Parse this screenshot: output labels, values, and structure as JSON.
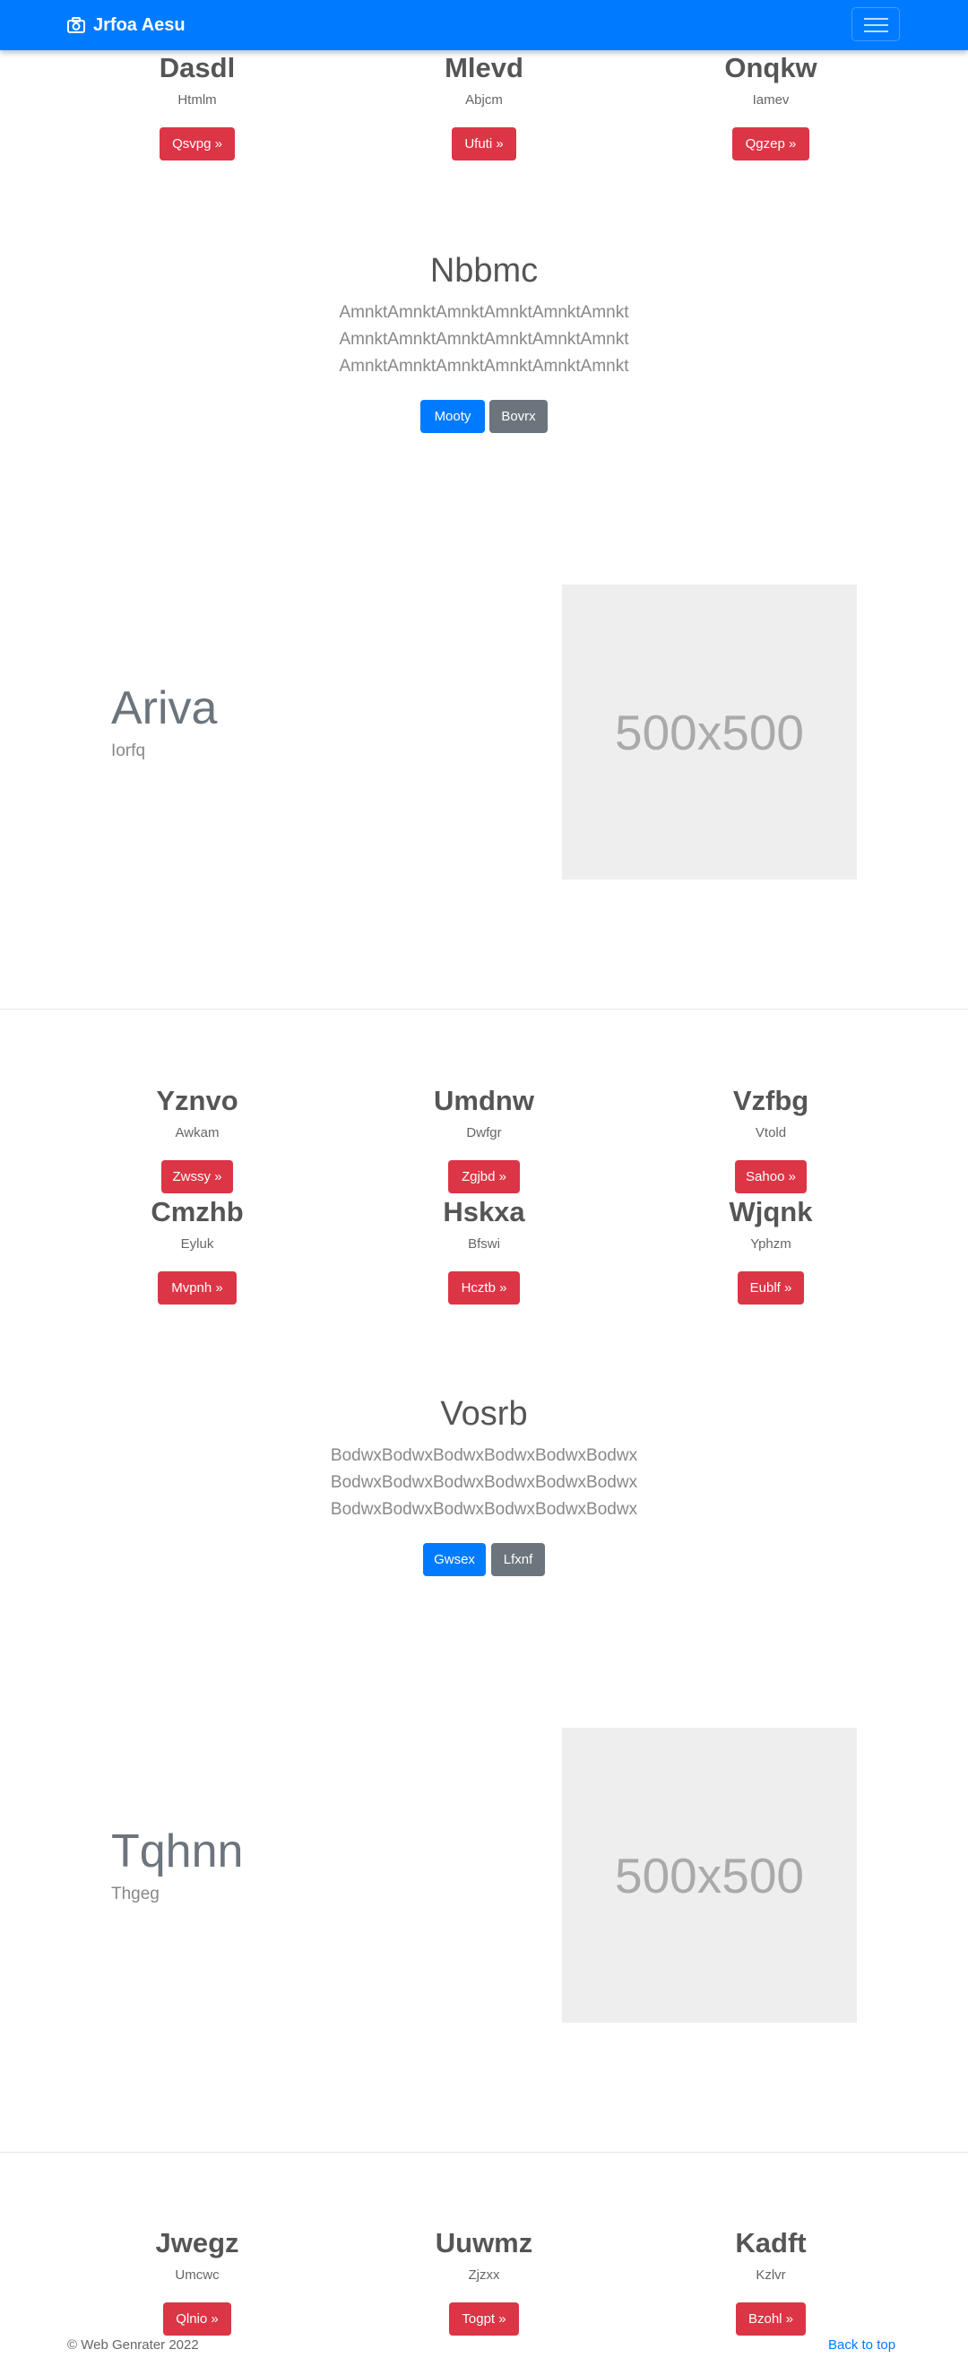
{
  "navbar": {
    "brand": "Jrfoa Aesu",
    "brand_icon": "camera-icon",
    "bg": "#007bff"
  },
  "section1": {
    "features": [
      {
        "title": "Dasdl",
        "subtitle": "Htmlm",
        "button": "Qsvpg »"
      },
      {
        "title": "Mlevd",
        "subtitle": "Abjcm",
        "button": "Ufuti »"
      },
      {
        "title": "Onqkw",
        "subtitle": "Iamev",
        "button": "Qgzep »"
      }
    ],
    "hero": {
      "title": "Nbbmc",
      "lines": [
        "AmnktAmnktAmnktAmnktAmnktAmnkt",
        "AmnktAmnktAmnktAmnktAmnktAmnkt",
        "AmnktAmnktAmnktAmnktAmnktAmnkt"
      ],
      "primary_button": "Mooty",
      "secondary_button": "Bovrx"
    },
    "split": {
      "title": "Ariva",
      "subtitle": "Iorfq",
      "image_label": "500x500"
    }
  },
  "section2": {
    "features_row1": [
      {
        "title": "Yznvo",
        "subtitle": "Awkam",
        "button": "Zwssy »"
      },
      {
        "title": "Umdnw",
        "subtitle": "Dwfgr",
        "button": "Zgjbd »"
      },
      {
        "title": "Vzfbg",
        "subtitle": "Vtold",
        "button": "Sahoo »"
      }
    ],
    "features_row2": [
      {
        "title": "Cmzhb",
        "subtitle": "Eyluk",
        "button": "Mvpnh »"
      },
      {
        "title": "Hskxa",
        "subtitle": "Bfswi",
        "button": "Hcztb »"
      },
      {
        "title": "Wjqnk",
        "subtitle": "Yphzm",
        "button": "Eublf »"
      }
    ],
    "hero": {
      "title": "Vosrb",
      "lines": [
        "BodwxBodwxBodwxBodwxBodwxBodwx",
        "BodwxBodwxBodwxBodwxBodwxBodwx",
        "BodwxBodwxBodwxBodwxBodwxBodwx"
      ],
      "primary_button": "Gwsex",
      "secondary_button": "Lfxnf"
    },
    "split": {
      "title": "Tqhnn",
      "subtitle": "Thgeg",
      "image_label": "500x500"
    }
  },
  "section3": {
    "features": [
      {
        "title": "Jwegz",
        "subtitle": "Umcwc",
        "button": "Qlnio »"
      },
      {
        "title": "Uuwmz",
        "subtitle": "Zjzxx",
        "button": "Togpt »"
      },
      {
        "title": "Kadft",
        "subtitle": "Kzlvr",
        "button": "Bzohl »"
      }
    ]
  },
  "footer": {
    "copyright": "© Web Genrater 2022",
    "back_to_top": "Back to top"
  },
  "colors": {
    "primary": "#007bff",
    "danger": "#dc3545",
    "secondary": "#6c757d"
  }
}
